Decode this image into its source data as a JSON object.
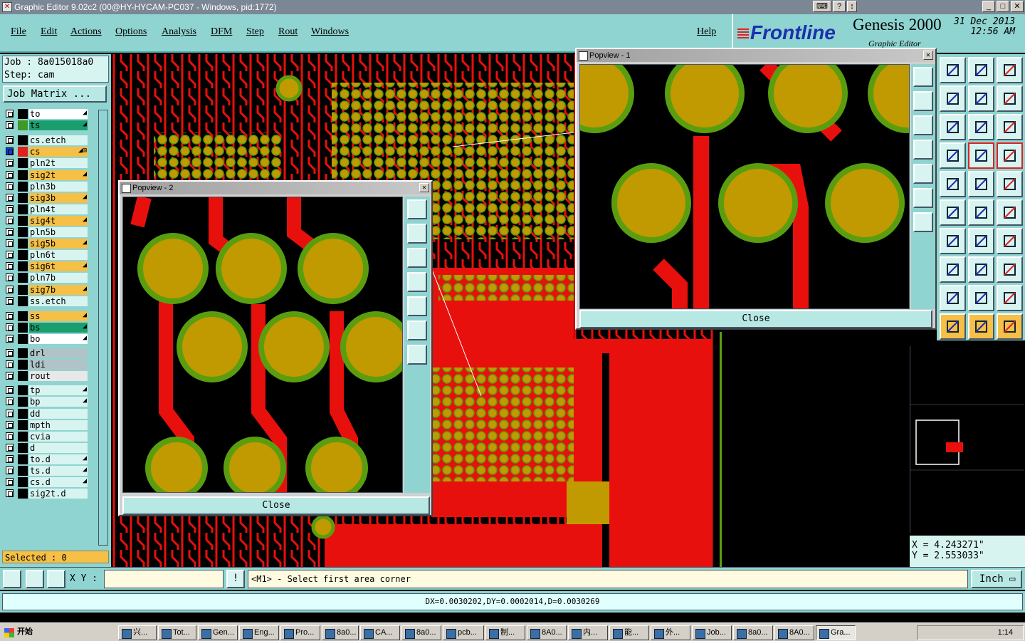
{
  "window": {
    "title": "Graphic Editor 9.02c2 (00@HY-HYCAM-PC037 - Windows, pid:1772)",
    "min": "_",
    "max": "□",
    "close": "✕"
  },
  "menu": [
    "File",
    "Edit",
    "Actions",
    "Options",
    "Analysis",
    "DFM",
    "Step",
    "Rout",
    "Windows"
  ],
  "help": "Help",
  "brand": {
    "logo": "Frontline",
    "product": "Genesis 2000",
    "date_line1": "31 Dec 2013",
    "date_line2": "12:56 AM",
    "subtitle": "Graphic Editor"
  },
  "job": {
    "job_label": "Job : 8a015018a0",
    "step_label": "Step: cam",
    "matrix_button": "Job Matrix ..."
  },
  "layers": [
    {
      "name": "to",
      "color": "#000000",
      "bg": "#ffffff",
      "arrow": "◢"
    },
    {
      "name": "ts",
      "color": "#3c9a25",
      "bg": "#1a9e6e",
      "arrow": "◢"
    },
    {
      "name": "cs.etch",
      "color": "#000000",
      "bg": "#d8f4f1",
      "arrow": ""
    },
    {
      "name": "cs",
      "color": "#e0201a",
      "bg": "#f6bf45",
      "arrow": "◢⊞",
      "active": true
    },
    {
      "name": "pln2t",
      "color": "#000000",
      "bg": "#d8f4f1",
      "arrow": ""
    },
    {
      "name": "sig2t",
      "color": "#000000",
      "bg": "#f6bf45",
      "arrow": "◢"
    },
    {
      "name": "pln3b",
      "color": "#000000",
      "bg": "#d8f4f1",
      "arrow": ""
    },
    {
      "name": "sig3b",
      "color": "#000000",
      "bg": "#f6bf45",
      "arrow": "◢"
    },
    {
      "name": "pln4t",
      "color": "#000000",
      "bg": "#d8f4f1",
      "arrow": ""
    },
    {
      "name": "sig4t",
      "color": "#000000",
      "bg": "#f6bf45",
      "arrow": "◢"
    },
    {
      "name": "pln5b",
      "color": "#000000",
      "bg": "#d8f4f1",
      "arrow": ""
    },
    {
      "name": "sig5b",
      "color": "#000000",
      "bg": "#f6bf45",
      "arrow": "◢"
    },
    {
      "name": "pln6t",
      "color": "#000000",
      "bg": "#d8f4f1",
      "arrow": ""
    },
    {
      "name": "sig6t",
      "color": "#000000",
      "bg": "#f6bf45",
      "arrow": "◢"
    },
    {
      "name": "pln7b",
      "color": "#000000",
      "bg": "#d8f4f1",
      "arrow": ""
    },
    {
      "name": "sig7b",
      "color": "#000000",
      "bg": "#f6bf45",
      "arrow": "◢"
    },
    {
      "name": "ss.etch",
      "color": "#000000",
      "bg": "#d8f4f1",
      "arrow": ""
    },
    {
      "name": "ss",
      "color": "#000000",
      "bg": "#f6bf45",
      "arrow": "◢"
    },
    {
      "name": "bs",
      "color": "#000000",
      "bg": "#1a9e6e",
      "arrow": "◢"
    },
    {
      "name": "bo",
      "color": "#000000",
      "bg": "#ffffff",
      "arrow": "◢"
    },
    {
      "name": "drl",
      "color": "#000000",
      "bg": "#b0c4c8",
      "arrow": ""
    },
    {
      "name": "ldi",
      "color": "#000000",
      "bg": "#b0c4c8",
      "arrow": ""
    },
    {
      "name": "rout",
      "color": "#000000",
      "bg": "#e8e8e8",
      "arrow": ""
    },
    {
      "name": "tp",
      "color": "#000000",
      "bg": "#d8f4f1",
      "arrow": "◢"
    },
    {
      "name": "bp",
      "color": "#000000",
      "bg": "#d8f4f1",
      "arrow": "◢"
    },
    {
      "name": "dd",
      "color": "#000000",
      "bg": "#d8f4f1",
      "arrow": ""
    },
    {
      "name": "mpth",
      "color": "#000000",
      "bg": "#d8f4f1",
      "arrow": ""
    },
    {
      "name": "cvia",
      "color": "#000000",
      "bg": "#d8f4f1",
      "arrow": ""
    },
    {
      "name": "d",
      "color": "#000000",
      "bg": "#d8f4f1",
      "arrow": ""
    },
    {
      "name": "to.d",
      "color": "#000000",
      "bg": "#d8f4f1",
      "arrow": "◢"
    },
    {
      "name": "ts.d",
      "color": "#000000",
      "bg": "#d8f4f1",
      "arrow": "◢"
    },
    {
      "name": "cs.d",
      "color": "#000000",
      "bg": "#d8f4f1",
      "arrow": "◢"
    },
    {
      "name": "sig2t.d",
      "color": "#000000",
      "bg": "#d8f4f1",
      "arrow": ""
    }
  ],
  "selected": "Selected : 0",
  "popview1": {
    "title": "Popview - 1",
    "close": "Close"
  },
  "popview2": {
    "title": "Popview - 2",
    "close": "Close"
  },
  "coords": {
    "x": "X = 4.243271\"",
    "y": "Y = 2.553033\""
  },
  "command": {
    "xy_label": "X Y :",
    "xy_value": "",
    "prompt": "<M1> - Select first area corner",
    "unit": "Inch"
  },
  "status": "DX=0.0030202,DY=0.0002014,D=0.0030269",
  "taskbar": {
    "start": "开始",
    "tasks": [
      "兴...",
      "Tot...",
      "Gen...",
      "Eng...",
      "Pro...",
      "8a0...",
      "CA...",
      "8a0...",
      "pcb...",
      "制...",
      "8A0...",
      "内...",
      "能...",
      "外...",
      "Job...",
      "8a0...",
      "8A0...",
      "Gra..."
    ],
    "clock": "1:14"
  },
  "colors": {
    "copper": "#e8100c",
    "pad": "#c09a00",
    "mask": "#5a9e10",
    "panel": "#8fd4d0"
  }
}
